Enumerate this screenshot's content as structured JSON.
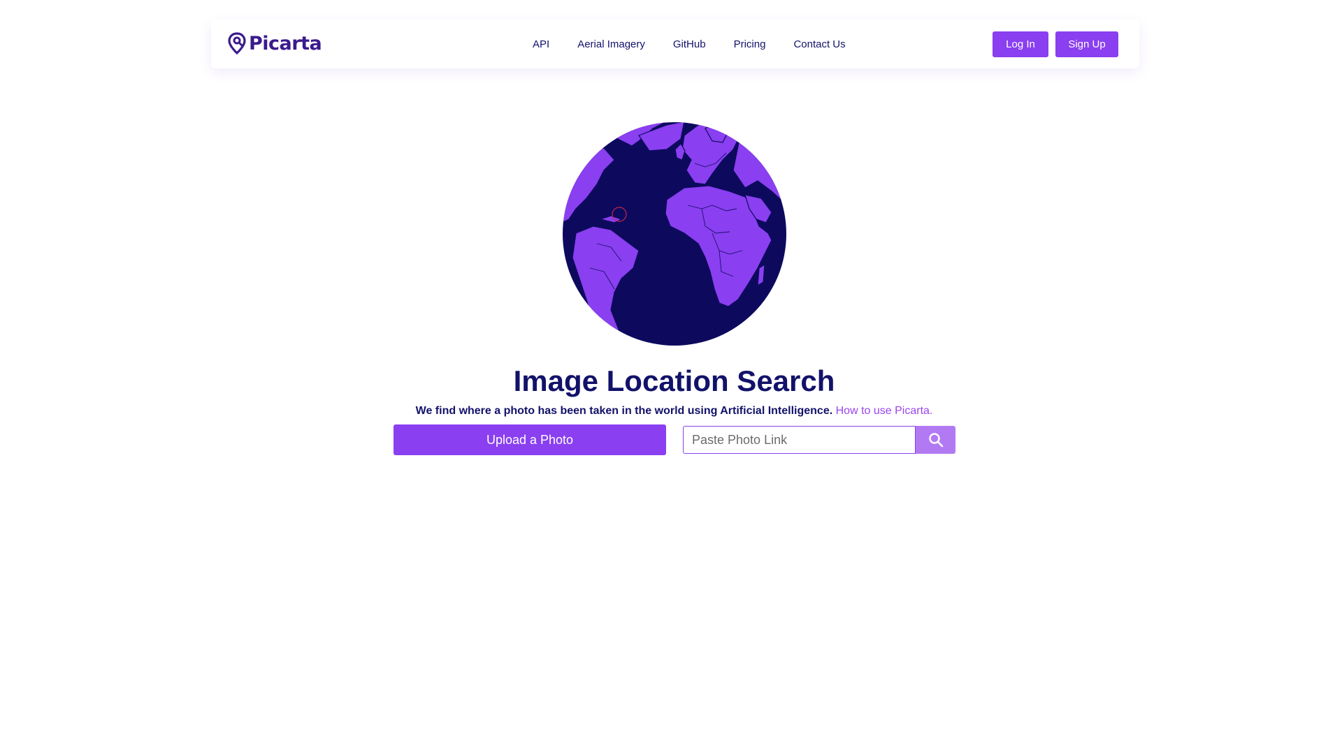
{
  "brand": {
    "name": "Picarta",
    "logo_color": "#3a1a8c"
  },
  "nav": {
    "links": [
      "API",
      "Aerial Imagery",
      "GitHub",
      "Pricing",
      "Contact Us"
    ],
    "login_label": "Log In",
    "signup_label": "Sign Up"
  },
  "hero": {
    "title": "Image Location Search",
    "subtitle": "We find where a photo has been taken in the world using Artificial Intelligence.",
    "help_link": "How to use Picarta."
  },
  "actions": {
    "upload_label": "Upload a Photo",
    "link_placeholder": "Paste Photo Link",
    "search_icon": "search-icon"
  },
  "colors": {
    "accent": "#8a3ff0",
    "accent_light": "#b27af2",
    "ocean": "#0d0a5e",
    "land": "#8a3ff0",
    "text_dark": "#12126a"
  }
}
